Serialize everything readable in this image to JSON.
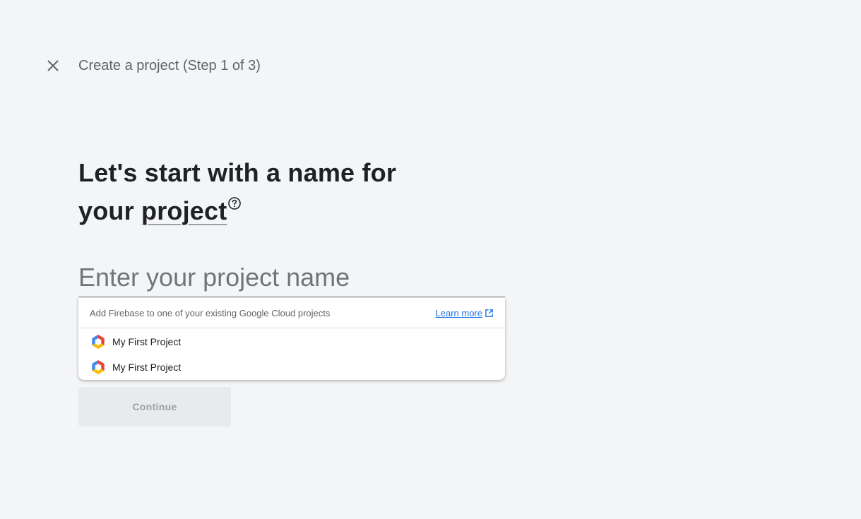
{
  "header": {
    "close_icon": "close-icon",
    "step_title": "Create a project (Step 1 of 3)"
  },
  "heading": {
    "line_prefix": "Let's start with a name for your ",
    "term": "project",
    "help_icon": "help-circle-icon"
  },
  "project_name_input": {
    "value": "",
    "placeholder": "Enter your project name"
  },
  "dropdown": {
    "hint": "Add Firebase to one of your existing Google Cloud projects",
    "learn_more_label": "Learn more",
    "learn_more_icon": "open-in-new-icon",
    "projects": [
      {
        "name": "My First Project",
        "icon": "google-cloud-icon"
      },
      {
        "name": "My First Project",
        "icon": "google-cloud-icon"
      }
    ]
  },
  "continue_button": {
    "label": "Continue",
    "disabled": true
  },
  "colors": {
    "background": "#f4f5f7",
    "link": "#1a73e8",
    "disabled_button_bg": "#e8eaed",
    "disabled_button_text": "#9aa0a6",
    "gc_blue": "#4285f4",
    "gc_red": "#ea4335",
    "gc_yellow": "#fbbc04"
  }
}
